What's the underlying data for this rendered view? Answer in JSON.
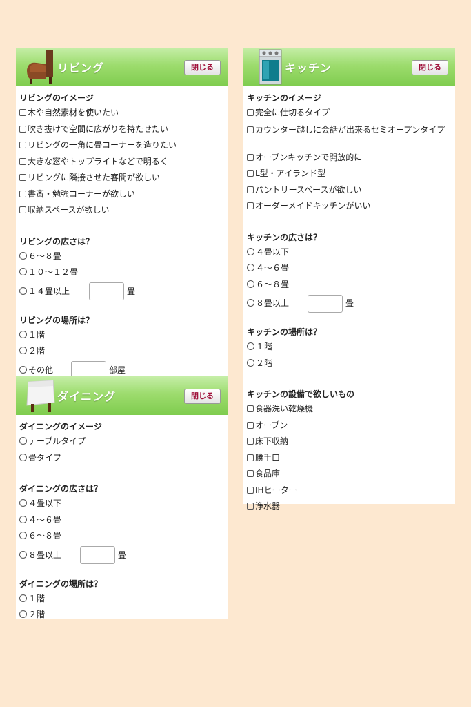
{
  "close_label": "閉じる",
  "living": {
    "title": "リビング",
    "image_section": {
      "title": "リビングのイメージ",
      "options": [
        "木や自然素材を使いたい",
        "吹き抜けで空間に広がりを持たせたい",
        "リビングの一角に畳コーナーを造りたい",
        "大きな窓やトップライトなどで明るく",
        "リビングに隣接させた客間が欲しい",
        "書斎・勉強コーナーが欲しい",
        "収納スペースが欲しい"
      ]
    },
    "size_section": {
      "title": "リビングの広さは？",
      "options": [
        "６～８畳",
        "１０～１２畳",
        "１４畳以上"
      ],
      "unit": "畳"
    },
    "location_section": {
      "title": "リビングの場所は？",
      "options": [
        "１階",
        "２階",
        "その他"
      ],
      "unit": "部屋"
    }
  },
  "dining": {
    "title": "ダイニング",
    "image_section": {
      "title": "ダイニングのイメージ",
      "options": [
        "テーブルタイプ",
        "畳タイプ"
      ]
    },
    "size_section": {
      "title": "ダイニングの広さは？",
      "options": [
        "４畳以下",
        "４～６畳",
        "６～８畳",
        "８畳以上"
      ],
      "unit": "畳"
    },
    "location_section": {
      "title": "ダイニングの場所は？",
      "options": [
        "１階",
        "２階"
      ]
    }
  },
  "kitchen": {
    "title": "キッチン",
    "image_section": {
      "title": "キッチンのイメージ",
      "options": [
        "完全に仕切るタイプ",
        "カウンター越しに会話が出来るセミオープンタイプ",
        "オープンキッチンで開放的に",
        "L型・アイランド型",
        "パントリースペースが欲しい",
        "オーダーメイドキッチンがいい"
      ]
    },
    "size_section": {
      "title": "キッチンの広さは？",
      "options": [
        "４畳以下",
        "４～６畳",
        "６～８畳",
        "８畳以上"
      ],
      "unit": "畳"
    },
    "location_section": {
      "title": "キッチンの場所は？",
      "options": [
        "１階",
        "２階"
      ]
    },
    "equipment_section": {
      "title": "キッチンの設備で欲しいもの",
      "options": [
        "食器洗い乾燥機",
        "オーブン",
        "床下収納",
        "勝手口",
        "食品庫",
        "IHヒーター",
        "浄水器"
      ]
    }
  },
  "icons": {
    "living": "sofa-icon",
    "dining": "dining-table-icon",
    "kitchen": "kitchen-stove-icon"
  },
  "colors": {
    "background": "#fde8d0",
    "header_green": "#8fd45e",
    "close_text": "#a0103a"
  }
}
